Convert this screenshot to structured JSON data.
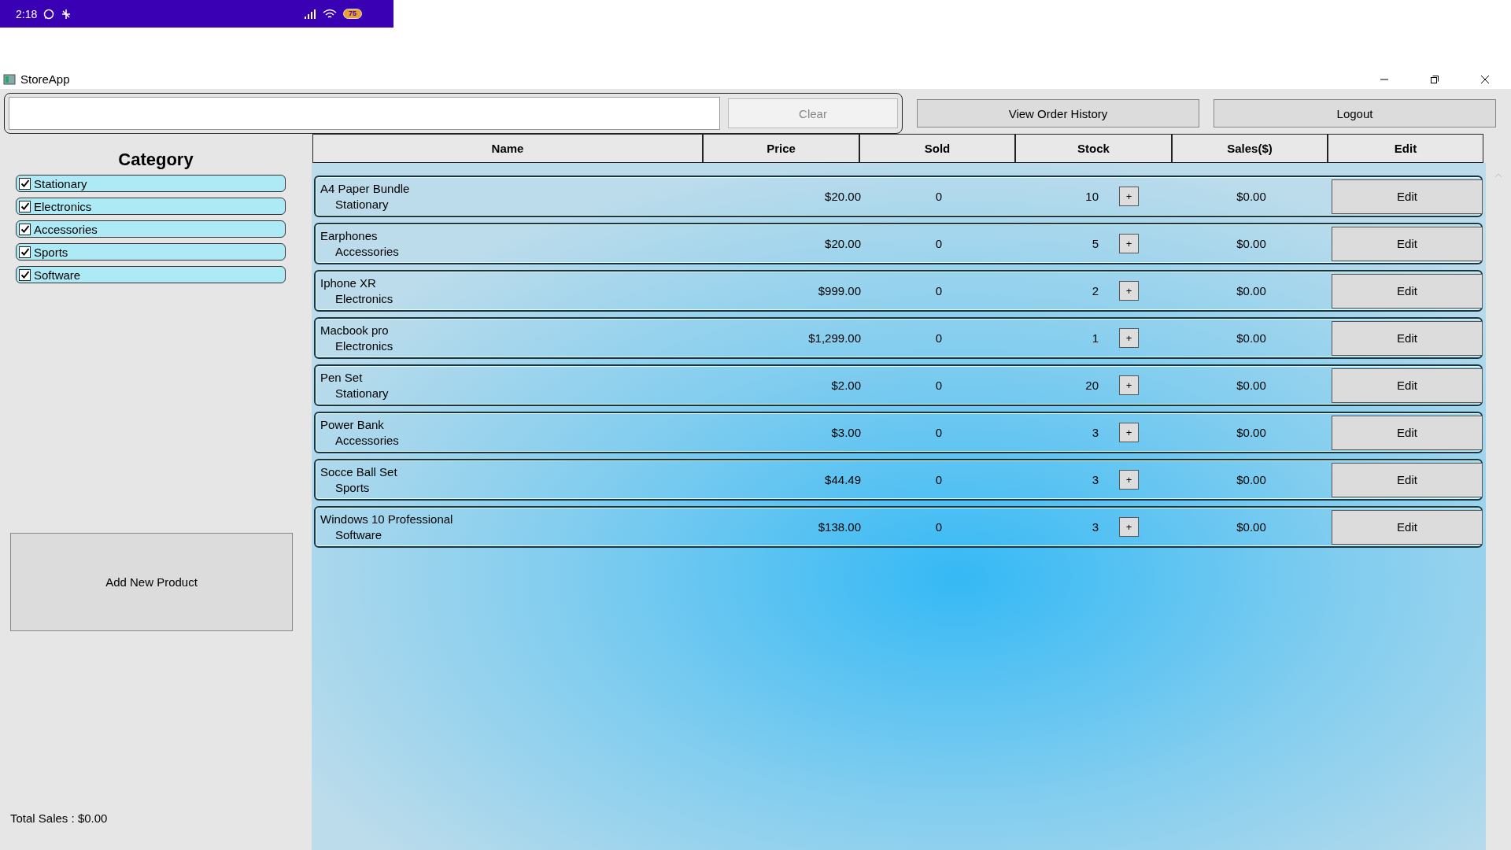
{
  "phone_status": {
    "time": "2:18",
    "battery": "75"
  },
  "window": {
    "title": "StoreApp"
  },
  "toolbar": {
    "clear_button": {
      "label": "Clear",
      "disabled": true
    },
    "buttons": [
      "View Order History",
      "Logout"
    ]
  },
  "sidebar": {
    "title": "Category",
    "categories": [
      {
        "label": "Stationary",
        "checked": true
      },
      {
        "label": "Electronics",
        "checked": true
      },
      {
        "label": "Accessories",
        "checked": true
      },
      {
        "label": "Sports",
        "checked": true
      },
      {
        "label": "Software",
        "checked": true
      }
    ],
    "add_button": "Add New Product",
    "total_sales": "Total Sales : $0.00"
  },
  "table": {
    "columns": [
      "Name",
      "Price",
      "Sold",
      "Stock",
      "Sales($)",
      "Edit"
    ],
    "rows": [
      {
        "name": "A4 Paper Bundle",
        "category": "Stationary",
        "price": "$20.00",
        "sold": "0",
        "stock": "10",
        "add": "+",
        "sales": "$0.00",
        "edit": "Edit"
      },
      {
        "name": "Earphones",
        "category": "Accessories",
        "price": "$20.00",
        "sold": "0",
        "stock": "5",
        "add": "+",
        "sales": "$0.00",
        "edit": "Edit"
      },
      {
        "name": "Iphone XR",
        "category": "Electronics",
        "price": "$999.00",
        "sold": "0",
        "stock": "2",
        "add": "+",
        "sales": "$0.00",
        "edit": "Edit"
      },
      {
        "name": "Macbook pro",
        "category": "Electronics",
        "price": "$1,299.00",
        "sold": "0",
        "stock": "1",
        "add": "+",
        "sales": "$0.00",
        "edit": "Edit"
      },
      {
        "name": "Pen Set",
        "category": "Stationary",
        "price": "$2.00",
        "sold": "0",
        "stock": "20",
        "add": "+",
        "sales": "$0.00",
        "edit": "Edit"
      },
      {
        "name": "Power Bank",
        "category": "Accessories",
        "price": "$3.00",
        "sold": "0",
        "stock": "3",
        "add": "+",
        "sales": "$0.00",
        "edit": "Edit"
      },
      {
        "name": "Socce Ball Set",
        "category": "Sports",
        "price": "$44.49",
        "sold": "0",
        "stock": "3",
        "add": "+",
        "sales": "$0.00",
        "edit": "Edit"
      },
      {
        "name": "Windows 10 Professional",
        "category": "Software",
        "price": "$138.00",
        "sold": "0",
        "stock": "3",
        "add": "+",
        "sales": "$0.00",
        "edit": "Edit"
      }
    ]
  }
}
